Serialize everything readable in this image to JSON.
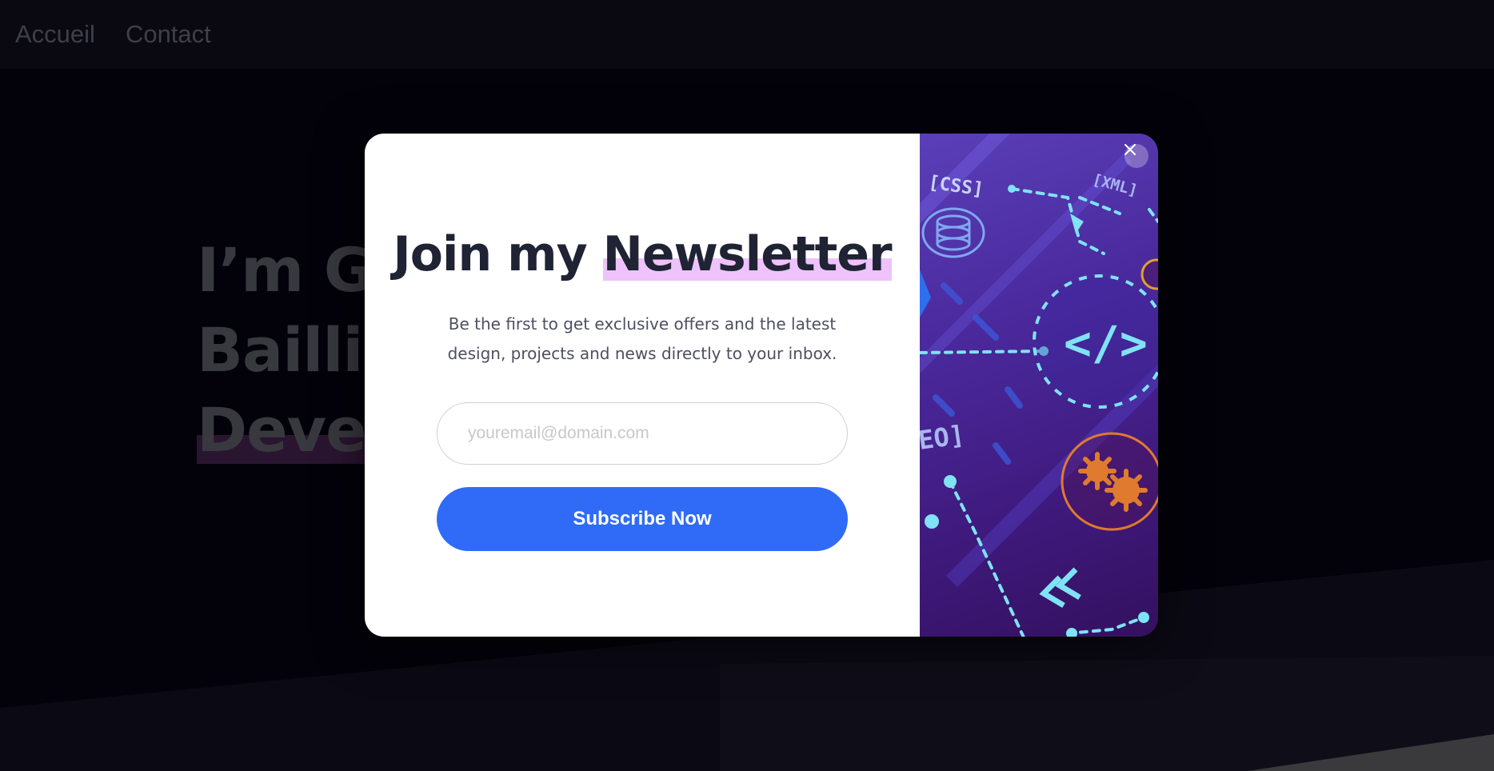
{
  "nav": {
    "items": [
      {
        "label": "Accueil"
      },
      {
        "label": "Contact"
      }
    ]
  },
  "hero": {
    "line1": "I’m Gu",
    "line2": "Baillie",
    "line3": "Develo"
  },
  "modal": {
    "title_part1": "Join my ",
    "title_highlight": "Newsletter",
    "description": "Be the first to get exclusive offers and the latest design, projects and news directly to your inbox.",
    "email_placeholder": "youremail@domain.com",
    "email_value": "",
    "subscribe_label": "Subscribe Now",
    "close_icon": "close-icon",
    "illustration": {
      "css_tag": "[CSS]",
      "xml_tag": "[XML]",
      "seo_tag": "EO]",
      "code_symbol": "</>"
    }
  },
  "colors": {
    "accent": "#306bf7",
    "highlight": "#eec2fb",
    "title": "#1f2333",
    "illustration_bg": "#4b2a9e"
  }
}
